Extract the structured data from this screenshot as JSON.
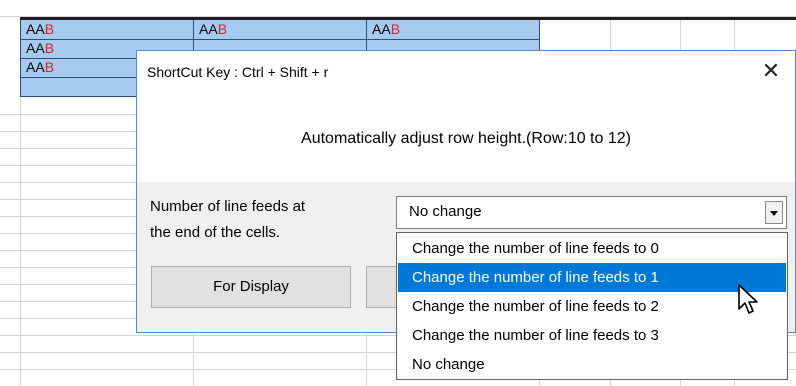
{
  "sheet": {
    "cells": [
      {
        "prefix": "AA",
        "suffix": "B"
      },
      {
        "prefix": "AA",
        "suffix": "B"
      },
      {
        "prefix": "AA",
        "suffix": "B"
      },
      {
        "prefix": "AA",
        "suffix": "B"
      },
      {
        "prefix": "AA",
        "suffix": "B"
      }
    ],
    "suffix_color": "#e02020",
    "selection_color": "#a6cbef"
  },
  "dialog": {
    "title": "ShortCut Key : Ctrl + Shift + r",
    "close_label": "✕",
    "message": "Automatically adjust row height.(Row:10 to 12)",
    "label_line1": "Number of line feeds at",
    "label_line2": "the end of the cells.",
    "combo_value": "No change",
    "button_display": "For Display"
  },
  "dropdown": {
    "options": [
      "Change the number of line feeds to 0",
      "Change the number of line feeds to 1",
      "Change the number of line feeds to 2",
      "Change the number of line feeds to 3",
      "No change"
    ],
    "selected_index": 1,
    "highlight_color": "#0078d7"
  }
}
